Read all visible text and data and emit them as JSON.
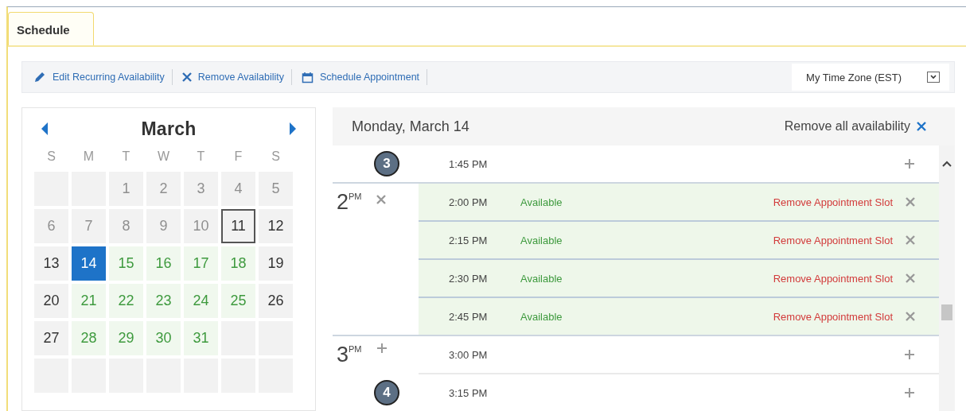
{
  "tabs": [
    {
      "label": "Schedule",
      "selected": true
    }
  ],
  "toolbar": {
    "actions": [
      {
        "label": "Edit Recurring Availability",
        "kind": "edit"
      },
      {
        "label": "Remove Availability",
        "kind": "remove"
      },
      {
        "label": "Schedule Appointment",
        "kind": "calendar"
      }
    ],
    "timezone": {
      "value": "My Time Zone (EST)"
    }
  },
  "calendar": {
    "month": "March",
    "weekdays": [
      "S",
      "M",
      "T",
      "W",
      "T",
      "F",
      "S"
    ],
    "days": [
      {
        "kind": "empty",
        "selected": false,
        "current": false
      },
      {
        "kind": "empty",
        "selected": false,
        "current": false
      },
      {
        "label": "1",
        "kind": "past",
        "selected": false,
        "current": false
      },
      {
        "label": "2",
        "kind": "past",
        "selected": false,
        "current": false
      },
      {
        "label": "3",
        "kind": "past",
        "selected": false,
        "current": false
      },
      {
        "label": "4",
        "kind": "past",
        "selected": false,
        "current": false
      },
      {
        "label": "5",
        "kind": "past",
        "selected": false,
        "current": false
      },
      {
        "label": "6",
        "kind": "past",
        "selected": false,
        "current": false
      },
      {
        "label": "7",
        "kind": "past",
        "selected": false,
        "current": false
      },
      {
        "label": "8",
        "kind": "past",
        "selected": false,
        "current": false
      },
      {
        "label": "9",
        "kind": "past",
        "selected": false,
        "current": false
      },
      {
        "label": "10",
        "kind": "past",
        "selected": false,
        "current": false
      },
      {
        "label": "11",
        "kind": "plain",
        "selected": false,
        "current": true
      },
      {
        "label": "12",
        "kind": "plain",
        "selected": false,
        "current": false
      },
      {
        "label": "13",
        "kind": "plain",
        "selected": false,
        "current": false
      },
      {
        "label": "14",
        "kind": "available",
        "selected": true,
        "current": false
      },
      {
        "label": "15",
        "kind": "available",
        "selected": false,
        "current": false
      },
      {
        "label": "16",
        "kind": "available",
        "selected": false,
        "current": false
      },
      {
        "label": "17",
        "kind": "available",
        "selected": false,
        "current": false
      },
      {
        "label": "18",
        "kind": "available",
        "selected": false,
        "current": false
      },
      {
        "label": "19",
        "kind": "plain",
        "selected": false,
        "current": false
      },
      {
        "label": "20",
        "kind": "plain",
        "selected": false,
        "current": false
      },
      {
        "label": "21",
        "kind": "available",
        "selected": false,
        "current": false
      },
      {
        "label": "22",
        "kind": "available",
        "selected": false,
        "current": false
      },
      {
        "label": "23",
        "kind": "available",
        "selected": false,
        "current": false
      },
      {
        "label": "24",
        "kind": "available",
        "selected": false,
        "current": false
      },
      {
        "label": "25",
        "kind": "available",
        "selected": false,
        "current": false
      },
      {
        "label": "26",
        "kind": "plain",
        "selected": false,
        "current": false
      },
      {
        "label": "27",
        "kind": "plain",
        "selected": false,
        "current": false
      },
      {
        "label": "28",
        "kind": "available",
        "selected": false,
        "current": false
      },
      {
        "label": "29",
        "kind": "available",
        "selected": false,
        "current": false
      },
      {
        "label": "30",
        "kind": "available",
        "selected": false,
        "current": false
      },
      {
        "label": "31",
        "kind": "available",
        "selected": false,
        "current": false
      },
      {
        "kind": "empty",
        "selected": false,
        "current": false
      },
      {
        "kind": "empty",
        "selected": false,
        "current": false
      },
      {
        "kind": "empty",
        "selected": false,
        "current": false
      },
      {
        "kind": "empty",
        "selected": false,
        "current": false
      },
      {
        "kind": "empty",
        "selected": false,
        "current": false
      },
      {
        "kind": "empty",
        "selected": false,
        "current": false
      },
      {
        "kind": "empty",
        "selected": false,
        "current": false
      },
      {
        "kind": "empty",
        "selected": false,
        "current": false
      },
      {
        "kind": "empty",
        "selected": false,
        "current": false
      }
    ]
  },
  "day_view": {
    "title": "Monday, March 14",
    "remove_all": "Remove all availability",
    "groups": [
      {
        "slots": [
          {
            "time": "1:45 PM",
            "available": false,
            "callout": "3"
          }
        ]
      },
      {
        "hour": "2",
        "period": "PM",
        "available": true,
        "slots": [
          {
            "time": "2:00 PM",
            "available": true,
            "status": "Available",
            "action": "Remove Appointment Slot"
          },
          {
            "time": "2:15 PM",
            "available": true,
            "status": "Available",
            "action": "Remove Appointment Slot"
          },
          {
            "time": "2:30 PM",
            "available": true,
            "status": "Available",
            "action": "Remove Appointment Slot"
          },
          {
            "time": "2:45 PM",
            "available": true,
            "status": "Available",
            "action": "Remove Appointment Slot"
          }
        ]
      },
      {
        "hour": "3",
        "period": "PM",
        "available": false,
        "slots": [
          {
            "time": "3:00 PM",
            "available": false
          },
          {
            "time": "3:15 PM",
            "available": false,
            "callout": "4"
          }
        ]
      }
    ]
  }
}
